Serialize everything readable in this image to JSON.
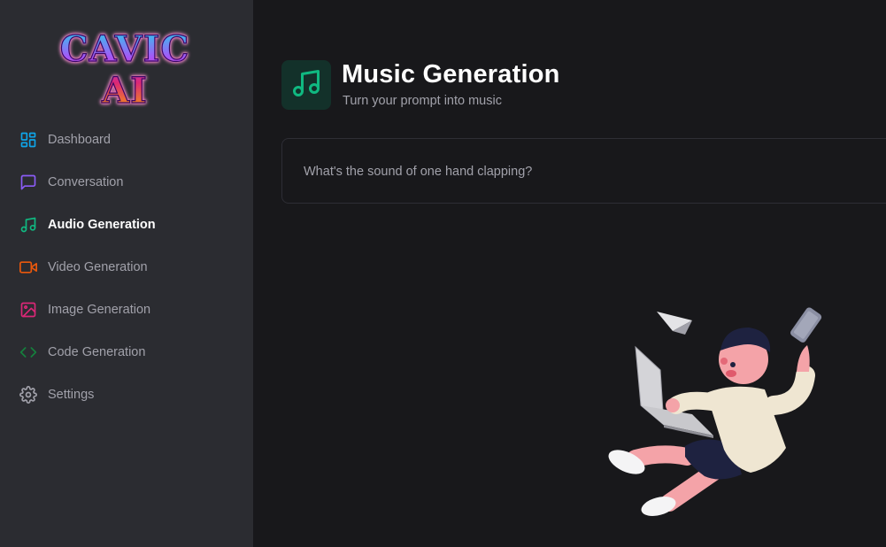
{
  "app": {
    "logo_text": "CAVIC AI"
  },
  "sidebar": {
    "items": [
      {
        "label": "Dashboard",
        "icon": "layout-grid-icon",
        "color": "#0ea5e9",
        "active": false
      },
      {
        "label": "Conversation",
        "icon": "message-square-icon",
        "color": "#8b5cf6",
        "active": false
      },
      {
        "label": "Audio Generation",
        "icon": "music-icon",
        "color": "#10b981",
        "active": true
      },
      {
        "label": "Video Generation",
        "icon": "video-icon",
        "color": "#ea580c",
        "active": false
      },
      {
        "label": "Image Generation",
        "icon": "image-icon",
        "color": "#db2777",
        "active": false
      },
      {
        "label": "Code Generation",
        "icon": "code-icon",
        "color": "#15803d",
        "active": false
      },
      {
        "label": "Settings",
        "icon": "gear-icon",
        "color": "#a1a1aa",
        "active": false
      }
    ]
  },
  "header": {
    "title": "Music Generation",
    "subtitle": "Turn your prompt into music",
    "icon": "music-icon",
    "icon_color": "#10b981",
    "icon_bg": "#13312a"
  },
  "prompt": {
    "placeholder": "What's the sound of one hand clapping?",
    "value": ""
  },
  "colors": {
    "sidebar_bg": "#2b2c31",
    "main_bg": "#18181b",
    "text_muted": "#a1a1aa",
    "text_primary": "#ffffff"
  }
}
